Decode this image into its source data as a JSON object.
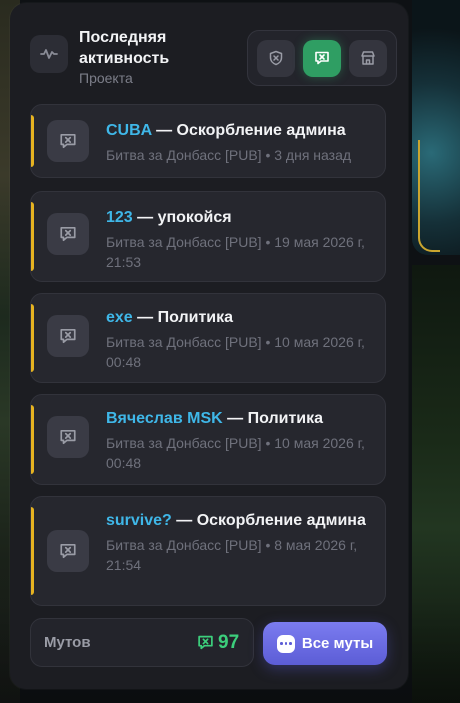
{
  "header": {
    "title": "Последняя активность",
    "subtitle": "Проекта",
    "icon": "activity-icon",
    "filters": [
      {
        "name": "shield-icon",
        "active": false
      },
      {
        "name": "mute-icon",
        "active": true
      },
      {
        "name": "store-icon",
        "active": false
      }
    ]
  },
  "items": [
    {
      "user": "CUBA",
      "sep": " — ",
      "reason": "Оскорбление админа",
      "meta": "Битва за Донбасс [PUB] • 3 дня назад"
    },
    {
      "user": "123",
      "sep": " — ",
      "reason": "упокойся",
      "meta": "Битва за Донбасс [PUB] • 19 мая 2026 г, 21:53"
    },
    {
      "user": "exe",
      "sep": " — ",
      "reason": "Политика",
      "meta": "Битва за Донбасс [PUB] • 10 мая 2026 г, 00:48"
    },
    {
      "user": "Вячеслав MSK",
      "sep": " — ",
      "reason": "Политика",
      "meta": "Битва за Донбасс [PUB] • 10 мая 2026 г, 00:48"
    },
    {
      "user": "survive?",
      "sep": " — ",
      "reason": "Оскорбление админа",
      "meta": "Битва за Донбасс [PUB] • 8 мая 2026 г, 21:54"
    }
  ],
  "footer": {
    "count_label": "Мутов",
    "count_value": "97",
    "all_button_label": "Все муты"
  },
  "colors": {
    "accent_user": "#3fb7e8",
    "stripe": "#e6b321",
    "active_filter": "#2f9e63",
    "count": "#3ccf7c",
    "button": "#6a6be4"
  }
}
